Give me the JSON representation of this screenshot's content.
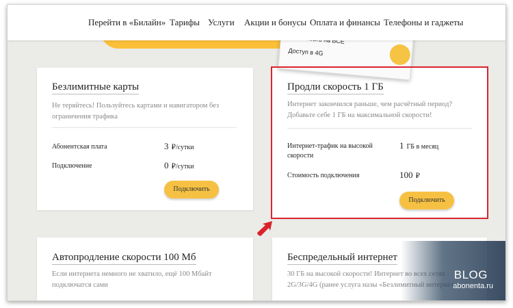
{
  "nav": {
    "items": [
      "Перейти в «Билайн»",
      "Тарифы",
      "Услуги",
      "Акции и бонусы",
      "Оплата и финансы",
      "Телефоны и гаджеты"
    ]
  },
  "phone_banner": {
    "line1": "пожаловать на ВСЕ",
    "line2": "Доступ в 4G"
  },
  "cards": {
    "unlimited_maps": {
      "title": "Безлимитные карты",
      "desc": "Не теряйтесь! Пользуйтесь картами и навигатором без ограничения трафика",
      "rows": [
        {
          "label": "Абонентская плата",
          "value": "3",
          "unit": "₽/сутки"
        },
        {
          "label": "Подключение",
          "value": "0",
          "unit": "₽/сутки"
        }
      ],
      "button": "Подключить"
    },
    "extend_speed": {
      "title": "Продли скорость 1 ГБ",
      "desc": "Интернет закончился раньше, чем расчётный период? Добавьте себе 1 ГБ на максимальной скорости!",
      "rows": [
        {
          "label": "Интернет-трафик на высокой скорости",
          "value": "1",
          "unit": "ГБ в месяц"
        },
        {
          "label": "Стоимость подключения",
          "value": "100",
          "unit": "₽"
        }
      ],
      "button": "Подключить"
    },
    "auto_renew": {
      "title": "Автопродление скорости 100 Мб",
      "desc": "Если интернета немного не хватило, ещё 100 Мбайт подключатся сами"
    },
    "unlimited_internet": {
      "title": "Беспредельный интернет",
      "desc": "30 ГБ на высокой скорости! Интернет во всех сетях 2G/3G/4G (ранее услуга назы «Безлимитный интернет»)."
    }
  },
  "watermark": {
    "blog": "BLOG",
    "site": "abonenta.ru"
  },
  "colors": {
    "accent_yellow": "#f6c143",
    "highlight_red": "#d9232c",
    "page_bg": "#ebebe8"
  }
}
